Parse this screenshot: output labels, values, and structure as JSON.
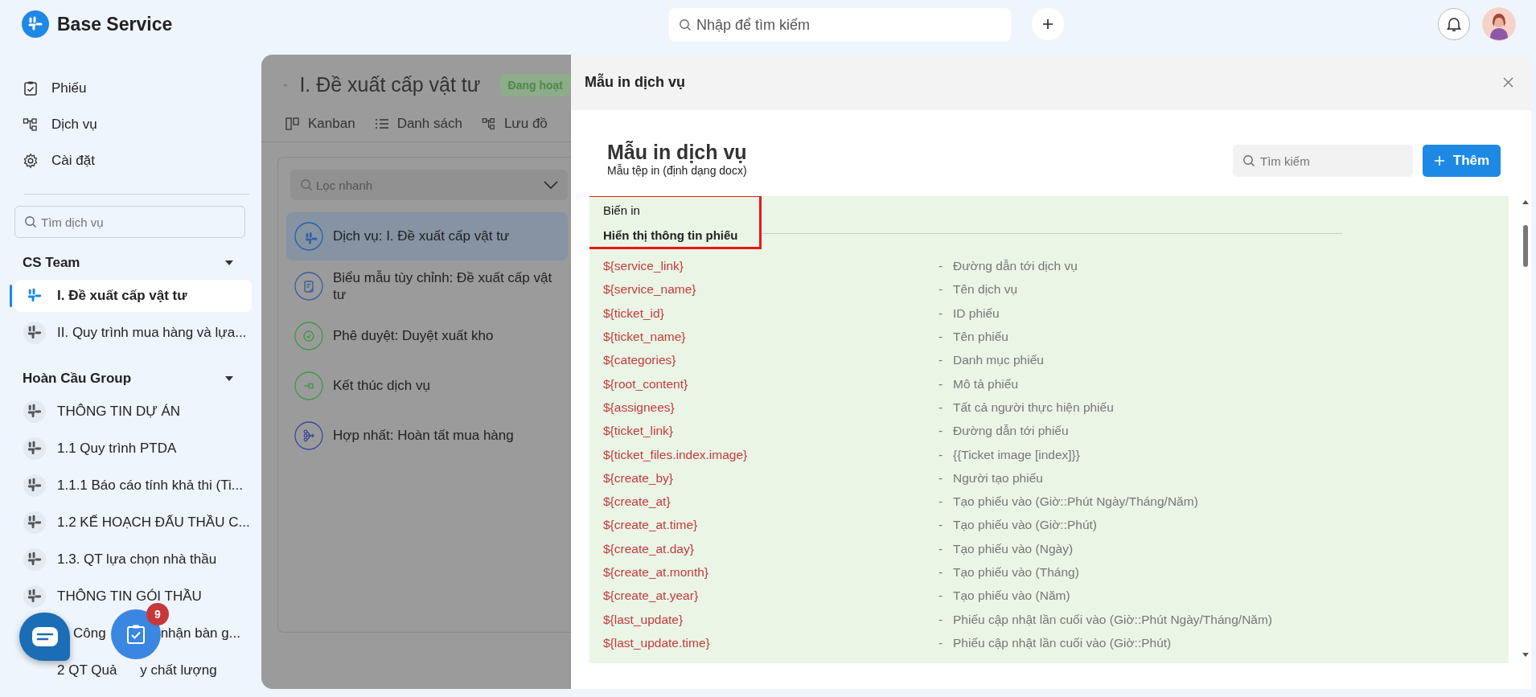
{
  "app": {
    "name": "Base Service"
  },
  "top_search": {
    "placeholder": "Nhập để tìm kiếm"
  },
  "sidebar": {
    "nav": [
      {
        "label": "Phiếu",
        "kind": "ticket"
      },
      {
        "label": "Dịch vụ",
        "kind": "service"
      },
      {
        "label": "Cài đặt",
        "kind": "settings"
      }
    ],
    "search": {
      "placeholder": "Tìm dịch vụ"
    },
    "groups": [
      {
        "name": "CS Team",
        "expanded": true,
        "items": [
          {
            "parts": [
              "I. Đề xuất cấp vật tư"
            ],
            "selected": true
          },
          {
            "parts": [
              "II. Quy trình mua hàng và lựa..."
            ],
            "selected": false
          }
        ]
      },
      {
        "name": "Hoàn Cầu Group",
        "expanded": true,
        "items": [
          {
            "parts": [
              "THÔNG TIN DỰ ÁN"
            ],
            "selected": false
          },
          {
            "parts": [
              "1.1 Quy trình PTDA"
            ],
            "selected": false
          },
          {
            "parts": [
              "1.1.1 Báo cáo tính khả thi (Ti..."
            ],
            "selected": false
          },
          {
            "parts": [
              "1.2 KẾ HOẠCH ĐẤU THẦU C..."
            ],
            "selected": false
          },
          {
            "parts": [
              "1.3. QT lựa chọn nhà thầu"
            ],
            "selected": false
          },
          {
            "parts": [
              "THÔNG TIN GÓI THẦU"
            ],
            "selected": false
          },
          {
            "parts": [
              "Công",
              "nhận bàn g..."
            ],
            "selected": false
          },
          {
            "parts": [
              "2 QT Quả",
              "y chất lượng"
            ],
            "selected": false
          }
        ]
      }
    ]
  },
  "fab": {
    "badge": "9"
  },
  "service": {
    "title": "I. Đề xuất cấp vật tư",
    "status": "Đang hoạt",
    "views": [
      {
        "label": "Kanban",
        "kind": "kanban"
      },
      {
        "label": "Danh sách",
        "kind": "list"
      },
      {
        "label": "Lưu đồ",
        "kind": "flow"
      }
    ],
    "filter": {
      "placeholder": "Lọc nhanh"
    },
    "steps": [
      {
        "label": "Dịch vụ: I. Đề xuất cấp vật tư",
        "kind": "service",
        "selected": true
      },
      {
        "label": "Biểu mẫu tùy chỉnh: Đề xuất cấp vật tư",
        "kind": "form",
        "selected": false
      },
      {
        "label": "Phê duyệt: Duyệt xuất kho",
        "kind": "approval",
        "selected": false
      },
      {
        "label": "Kết thúc dịch vụ",
        "kind": "end",
        "selected": false
      },
      {
        "label": "Hợp nhất: Hoàn tất mua hàng",
        "kind": "merge",
        "selected": false
      }
    ]
  },
  "drawer": {
    "title": "Mẫu in dịch vụ",
    "heading": "Mẫu in dịch vụ",
    "subtitle": "Mẫu tệp in (định dạng docx)",
    "search": {
      "placeholder": "Tìm kiếm"
    },
    "add_button": "Thêm",
    "section": {
      "label": "Biến in",
      "title": "Hiển thị thông tin phiếu",
      "highlighted": true
    },
    "variables": [
      {
        "name": "${service_link}",
        "separator": "-",
        "description": "Đường dẫn tới dịch vụ"
      },
      {
        "name": "${service_name}",
        "separator": "-",
        "description": "Tên dịch vụ"
      },
      {
        "name": "${ticket_id}",
        "separator": "-",
        "description": "ID phiếu"
      },
      {
        "name": "${ticket_name}",
        "separator": "-",
        "description": "Tên phiếu"
      },
      {
        "name": "${categories}",
        "separator": "-",
        "description": "Danh mục phiếu"
      },
      {
        "name": "${root_content}",
        "separator": "-",
        "description": "Mô tả phiếu"
      },
      {
        "name": "${assignees}",
        "separator": "-",
        "description": "Tất cả người thực hiện phiếu"
      },
      {
        "name": "${ticket_link}",
        "separator": "-",
        "description": "Đường dẫn tới phiếu"
      },
      {
        "name": "${ticket_files.index.image}",
        "separator": "-",
        "description": "{{Ticket image [index]}}"
      },
      {
        "name": "${create_by}",
        "separator": "-",
        "description": "Người tạo phiếu"
      },
      {
        "name": "${create_at}",
        "separator": "-",
        "description": "Tạo phiếu vào (Giờ::Phút Ngày/Tháng/Năm)"
      },
      {
        "name": "${create_at.time}",
        "separator": "-",
        "description": "Tạo phiếu vào (Giờ::Phút)"
      },
      {
        "name": "${create_at.day}",
        "separator": "-",
        "description": "Tạo phiếu vào (Ngày)"
      },
      {
        "name": "${create_at.month}",
        "separator": "-",
        "description": "Tạo phiếu vào (Tháng)"
      },
      {
        "name": "${create_at.year}",
        "separator": "-",
        "description": "Tạo phiếu vào (Năm)"
      },
      {
        "name": "${last_update}",
        "separator": "-",
        "description": "Phiếu cập nhật lần cuối vào (Giờ::Phút Ngày/Tháng/Năm)"
      },
      {
        "name": "${last_update.time}",
        "separator": "-",
        "description": "Phiếu cập nhật lần cuối vào (Giờ::Phút)"
      }
    ]
  }
}
